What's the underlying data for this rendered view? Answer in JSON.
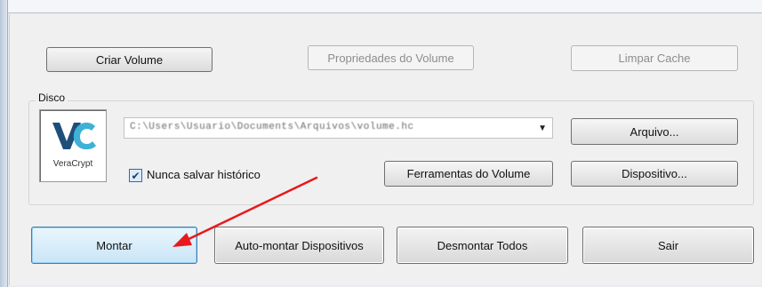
{
  "buttons": {
    "create_volume": "Criar Volume",
    "volume_properties": "Propriedades do Volume",
    "wipe_cache": "Limpar Cache",
    "file": "Arquivo...",
    "volume_tools": "Ferramentas do Volume",
    "device": "Dispositivo...",
    "mount": "Montar",
    "auto_mount": "Auto-montar Dispositivos",
    "dismount_all": "Desmontar Todos",
    "exit": "Sair"
  },
  "disk_group": {
    "label": "Disco",
    "logo_text": "VeraCrypt",
    "volume_path": "C:\\Users\\Usuario\\Documents\\Arquivos\\volume.hc",
    "never_save_history_label": "Nunca salvar histórico",
    "never_save_history_checked": true
  },
  "colors": {
    "logo_primary": "#1f4e7a",
    "logo_accent": "#3fb0d6",
    "annotation_arrow": "#e8191c"
  },
  "icons": {
    "logo": "veracrypt-logo-icon",
    "dropdown": "dropdown-arrow-icon",
    "checkmark": "checkmark-icon",
    "annotation": "red-arrow-annotation"
  }
}
